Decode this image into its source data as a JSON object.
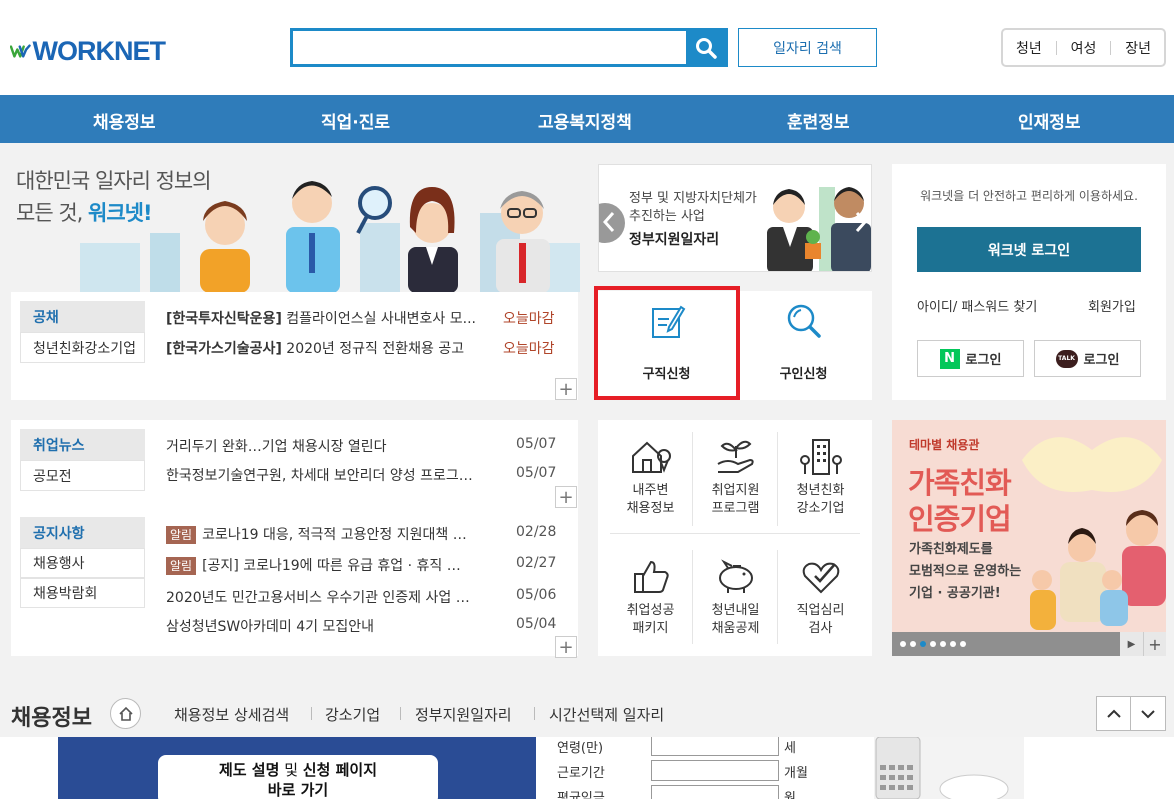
{
  "header": {
    "logo": "WORKNET",
    "search_placeholder": "",
    "search_button": "일자리 검색",
    "target_tabs": [
      "청년",
      "여성",
      "장년"
    ]
  },
  "nav": [
    "채용정보",
    "직업·진로",
    "고용복지정책",
    "훈련정보",
    "인재정보"
  ],
  "hero": {
    "line1": "대한민국 일자리 정보의",
    "line2_prefix": "모든 것, ",
    "line2_accent": "워크넷!"
  },
  "hiring": {
    "tabs": [
      "공채",
      "청년친화강소기업"
    ],
    "items": [
      {
        "company": "[한국투자신탁운용]",
        "title": "컴플라이언스실 사내변호사 모...",
        "deadline": "오늘마감"
      },
      {
        "company": "[한국가스기술공사]",
        "title": "2020년 정규직 전환채용 공고",
        "deadline": "오늘마감"
      }
    ]
  },
  "gov_banner": {
    "line1": "정부 및 지방자치단체가",
    "line2": "추진하는 사업",
    "line3": "정부지원일자리"
  },
  "quick": {
    "job_seek": "구직신청",
    "job_offer": "구인신청"
  },
  "login": {
    "message": "워크넷을 더 안전하고 편리하게 이용하세요.",
    "login_button": "워크넷 로그인",
    "find_account": "아이디/ 패스워드 찾기",
    "join": "회원가입",
    "naver_badge": "N",
    "naver_login": "로그인",
    "kakao_badge": "TALK",
    "kakao_login": "로그인"
  },
  "news": {
    "tabs": [
      "취업뉴스",
      "공모전"
    ],
    "items": [
      {
        "title": "거리두기 완화…기업 채용시장 열린다",
        "date": "05/07"
      },
      {
        "title": "한국정보기술연구원, 차세대 보안리더 양성 프로그…",
        "date": "05/07"
      }
    ]
  },
  "notice": {
    "tabs": [
      "공지사항",
      "채용행사",
      "채용박람회"
    ],
    "items": [
      {
        "tag": "알림",
        "title": "코로나19 대응, 적극적 고용안정 지원대책 …",
        "date": "02/28"
      },
      {
        "tag": "알림",
        "title": "[공지] 코로나19에 따른 유급 휴업 · 휴직 …",
        "date": "02/27"
      },
      {
        "tag": "",
        "title": "2020년도 민간고용서비스 우수기관 인증제 사업 …",
        "date": "05/06"
      },
      {
        "tag": "",
        "title": "삼성청년SW아카데미 4기 모집안내",
        "date": "05/04"
      }
    ]
  },
  "menu": {
    "items": [
      {
        "line1": "내주변",
        "line2": "채용정보"
      },
      {
        "line1": "취업지원",
        "line2": "프로그램"
      },
      {
        "line1": "청년친화",
        "line2": "강소기업"
      },
      {
        "line1": "취업성공",
        "line2": "패키지"
      },
      {
        "line1": "청년내일",
        "line2": "채움공제"
      },
      {
        "line1": "직업심리",
        "line2": "검사"
      }
    ]
  },
  "theme": {
    "label": "테마별 채용관",
    "title1": "가족친화",
    "title2": "인증기업",
    "desc1": "가족친화제도를",
    "desc2": "모범적으로 운영하는",
    "desc3": "기업 · 공공기관!"
  },
  "section": {
    "title": "채용정보",
    "links": [
      "채용정보 상세검색",
      "강소기업",
      "정부지원일자리",
      "시간선택제 일자리"
    ]
  },
  "bottom": {
    "banner_line1_a": "제도 설명",
    "banner_line1_b": " 및 ",
    "banner_line1_c": "신청 페이지",
    "banner_line2": "바로 가기",
    "form_labels": [
      "연령(만)",
      "근로기간",
      "평균임금"
    ],
    "form_units": [
      "세",
      "개월",
      "원"
    ]
  },
  "colors": {
    "primary": "#2f7cba",
    "accent": "#1d8ac8",
    "highlight": "#e61e26",
    "login_button": "#1c7293"
  }
}
